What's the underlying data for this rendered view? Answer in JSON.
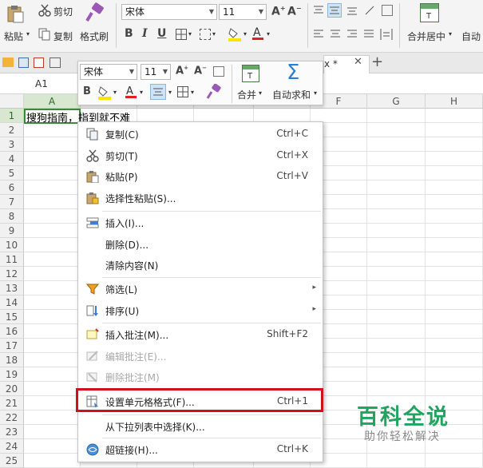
{
  "ribbon": {
    "cut": "剪切",
    "paste": "粘贴",
    "copy": "复制",
    "format_painter": "格式刷",
    "font_name": "宋体",
    "font_size": "11",
    "merge_center": "合并居中",
    "auto": "自动",
    "bold": "B",
    "italic": "I",
    "underline": "U"
  },
  "tabs": {
    "doc_title": "x *"
  },
  "formula": {
    "cell_ref": "A1"
  },
  "grid": {
    "columns": [
      "A",
      "B",
      "C",
      "D",
      "E",
      "F",
      "G",
      "H"
    ],
    "rows": [
      "1",
      "2",
      "3",
      "4",
      "5",
      "6",
      "7",
      "8",
      "9",
      "10",
      "11",
      "12",
      "13",
      "14",
      "15",
      "16",
      "17",
      "18",
      "19",
      "20",
      "21",
      "22",
      "23",
      "24",
      "25"
    ],
    "a1_text": "搜狗指南，指到就不难"
  },
  "mini_toolbar": {
    "font_name": "宋体",
    "font_size": "11",
    "bold": "B",
    "merge": "合并",
    "autosum": "自动求和"
  },
  "menu": {
    "items": [
      {
        "label": "复制(C)",
        "shortcut": "Ctrl+C"
      },
      {
        "label": "剪切(T)",
        "shortcut": "Ctrl+X"
      },
      {
        "label": "粘贴(P)",
        "shortcut": "Ctrl+V"
      },
      {
        "label": "选择性粘贴(S)...",
        "shortcut": ""
      },
      {
        "label": "插入(I)...",
        "shortcut": ""
      },
      {
        "label": "删除(D)...",
        "shortcut": ""
      },
      {
        "label": "清除内容(N)",
        "shortcut": ""
      },
      {
        "label": "筛选(L)",
        "shortcut": ""
      },
      {
        "label": "排序(U)",
        "shortcut": ""
      },
      {
        "label": "插入批注(M)...",
        "shortcut": "Shift+F2"
      },
      {
        "label": "编辑批注(E)...",
        "shortcut": ""
      },
      {
        "label": "删除批注(M)",
        "shortcut": ""
      },
      {
        "label": "设置单元格格式(F)...",
        "shortcut": "Ctrl+1"
      },
      {
        "label": "从下拉列表中选择(K)...",
        "shortcut": ""
      },
      {
        "label": "超链接(H)...",
        "shortcut": "Ctrl+K"
      }
    ]
  },
  "watermark": {
    "title": "百科全说",
    "subtitle": "助你轻松解决"
  },
  "colors": {
    "highlight": "#d0111b",
    "watermark_green": "#1fa55f",
    "font_red": "#e02020",
    "fill_yellow": "#ffe400"
  }
}
